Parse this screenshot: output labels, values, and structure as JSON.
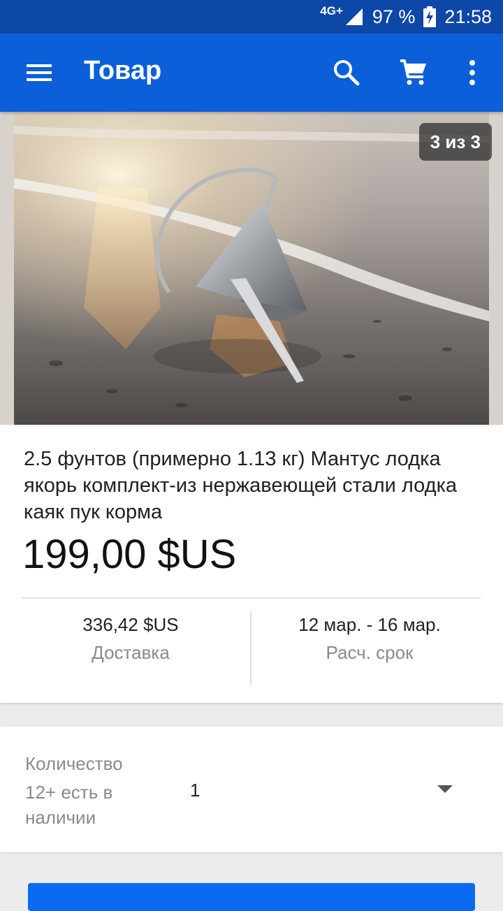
{
  "status_bar": {
    "network": "4G+",
    "battery": "97 %",
    "time": "21:58"
  },
  "app_bar": {
    "title": "Товар",
    "icons": [
      "menu-icon",
      "search-icon",
      "cart-icon",
      "more-vert-icon"
    ]
  },
  "gallery": {
    "counter": "3 из 3"
  },
  "product": {
    "title": "2.5 фунтов (примерно 1.13 кг) Мантус лодка якорь комплект-из нержавеющей стали лодка каяк пук корма",
    "price": "199,00 $US",
    "shipping_value": "336,42 $US",
    "shipping_label": "Доставка",
    "delivery_value": "12 мар. - 16 мар.",
    "delivery_label": "Расч. срок"
  },
  "quantity": {
    "label": "Количество",
    "stock": "12+ есть в наличии",
    "value": "1"
  },
  "colors": {
    "status_bar": "#0d47a8",
    "app_bar": "#0b5fd8",
    "accent": "#0b6af0"
  }
}
